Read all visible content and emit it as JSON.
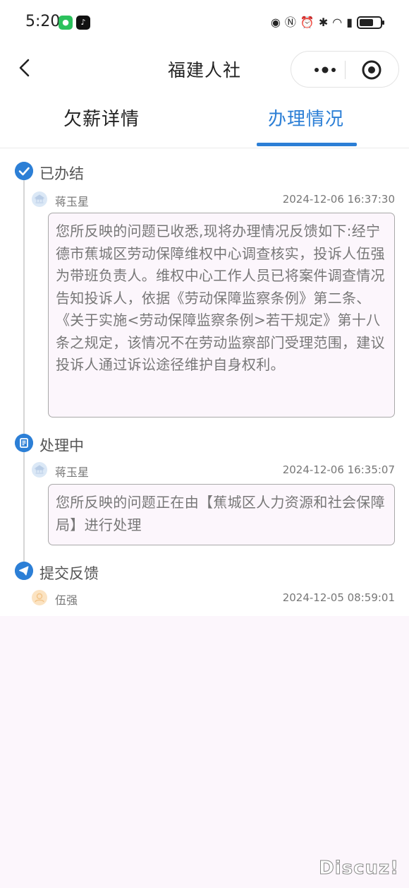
{
  "status_bar": {
    "time": "5:20"
  },
  "nav": {
    "title": "福建人社"
  },
  "tabs": [
    {
      "label": "欠薪详情",
      "active": false
    },
    {
      "label": "办理情况",
      "active": true
    }
  ],
  "timeline": [
    {
      "status": "已办结",
      "person": "蒋玉星",
      "time": "2024-12-06 16:37:30",
      "message": "您所反映的问题已收悉,现将办理情况反馈如下:经宁德市蕉城区劳动保障维权中心调查核实，投诉人伍强为带班负责人。维权中心工作人员已将案件调查情况告知投诉人，依据《劳动保障监察条例》第二条、《关于实施<劳动保障监察条例>若干规定》第十八条之规定，该情况不在劳动监察部门受理范围，建议投诉人通过诉讼途径维护自身权利。"
    },
    {
      "status": "处理中",
      "person": "蒋玉星",
      "time": "2024-12-06 16:35:07",
      "message": "您所反映的问题正在由【蕉城区人力资源和社会保障局】进行处理"
    },
    {
      "status": "提交反馈",
      "person": "伍强",
      "time": "2024-12-05 08:59:01",
      "message": ""
    }
  ],
  "watermark": "Discuz!",
  "colors": {
    "accent": "#2c7fd6",
    "background": "#fcf6fc",
    "bubble_border": "#a9a9a9"
  }
}
